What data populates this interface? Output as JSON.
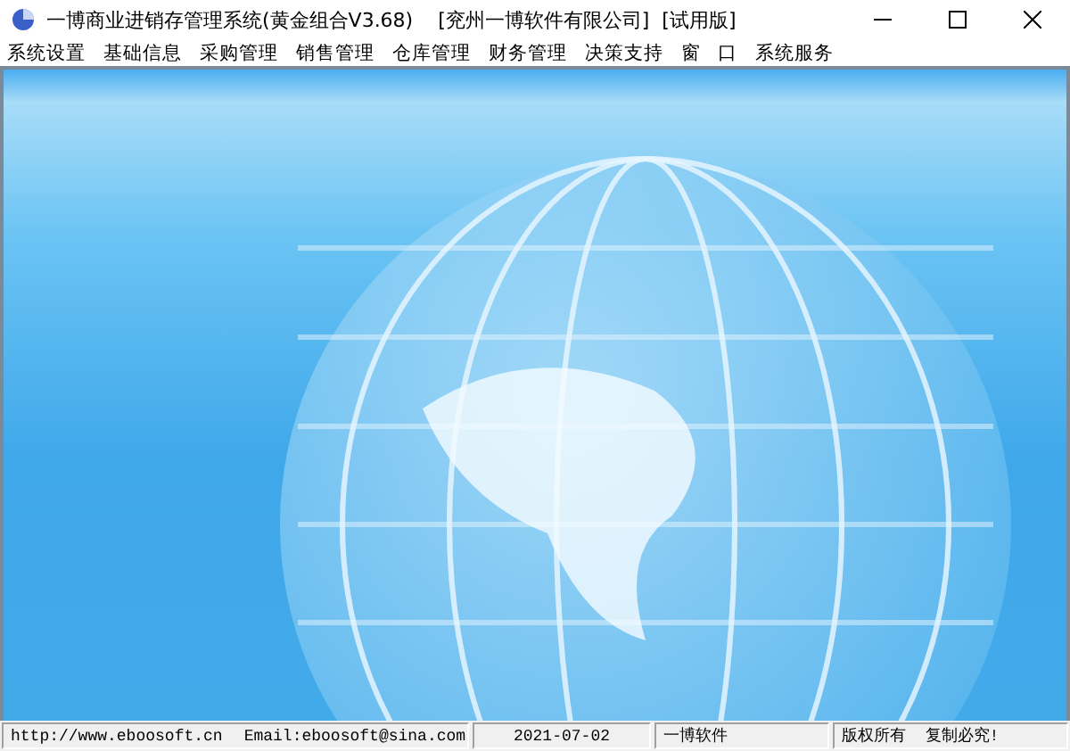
{
  "window": {
    "title": "一博商业进销存管理系统(黄金组合V3.68)    [兖州一博软件有限公司]  [试用版]"
  },
  "menu": [
    "系统设置",
    "基础信息",
    "采购管理",
    "销售管理",
    "仓库管理",
    "财务管理",
    "决策支持",
    "窗 口",
    "系统服务"
  ],
  "status_bar": [
    {
      "texts": [
        "http://www.eboosoft.cn",
        "Email:eboosoft@sina.com"
      ]
    },
    {
      "texts": [
        "2021-07-02"
      ]
    },
    {
      "texts": [
        "一博软件"
      ]
    },
    {
      "texts": [
        "版权所有  复制必究!"
      ]
    }
  ]
}
